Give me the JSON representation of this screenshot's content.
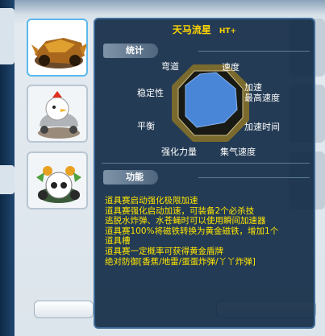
{
  "header": {
    "title": ""
  },
  "tooltip": {
    "title": "天马流星",
    "badge": "HT+",
    "stats_heading": "统计",
    "features_heading": "功能",
    "stats": [
      {
        "label": "弯道"
      },
      {
        "label": "速度"
      },
      {
        "label": "加速"
      },
      {
        "label": "最高速度"
      },
      {
        "label": "加速时间"
      },
      {
        "label": "集气速度"
      },
      {
        "label": "强化力量"
      },
      {
        "label": "平衡"
      },
      {
        "label": "稳定性"
      }
    ],
    "features": [
      "道具赛启动强化极限加速",
      "道具赛强化启动加速，可装备2个必杀技",
      "逃脱水炸弹、水苍蝇时可以使用瞬间加速器",
      "道具赛100%将磁铁转换为黄金磁铁，增加1个",
      "道具槽",
      "道具赛一定概率可获得黄金盾牌",
      "绝对防御[香蕉/地雷/蛋蛋炸弹/丫丫炸弹]"
    ]
  },
  "items": [
    {
      "name": "kart-item-1",
      "selected": true
    },
    {
      "name": "kart-item-2",
      "selected": false
    },
    {
      "name": "kart-item-3",
      "selected": false
    }
  ],
  "colors": {
    "tooltip_bg": "#102844",
    "title": "#ffd400",
    "feature_text": "#ffe600",
    "radar_fill": "#4a86d8",
    "radar_ring": "#7a6a2e",
    "selected_border": "#5ab8ee"
  }
}
